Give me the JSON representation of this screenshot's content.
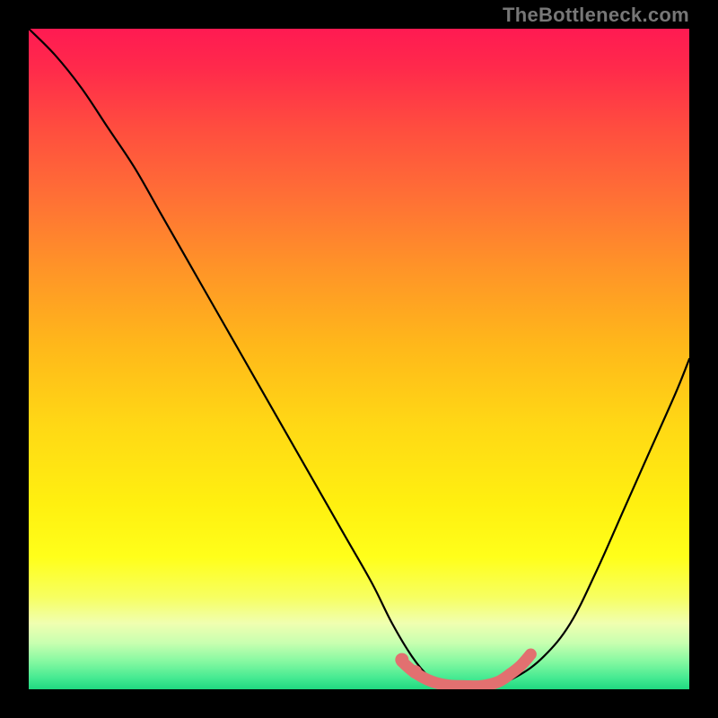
{
  "watermark": "TheBottleneck.com",
  "colors": {
    "frame": "#000000",
    "curve": "#000000",
    "marker": "#e27070",
    "watermark": "#777777"
  },
  "gradient_stops": [
    {
      "offset": 0.0,
      "color": "#ff1a52"
    },
    {
      "offset": 0.06,
      "color": "#ff2a4b"
    },
    {
      "offset": 0.15,
      "color": "#ff4d3f"
    },
    {
      "offset": 0.25,
      "color": "#ff6e36"
    },
    {
      "offset": 0.36,
      "color": "#ff9328"
    },
    {
      "offset": 0.48,
      "color": "#ffb81a"
    },
    {
      "offset": 0.6,
      "color": "#ffd815"
    },
    {
      "offset": 0.72,
      "color": "#fff010"
    },
    {
      "offset": 0.8,
      "color": "#ffff1a"
    },
    {
      "offset": 0.86,
      "color": "#f7ff60"
    },
    {
      "offset": 0.9,
      "color": "#f0ffb0"
    },
    {
      "offset": 0.93,
      "color": "#c8ffb0"
    },
    {
      "offset": 0.96,
      "color": "#80f8a0"
    },
    {
      "offset": 0.985,
      "color": "#40e890"
    },
    {
      "offset": 1.0,
      "color": "#20d880"
    }
  ],
  "chart_data": {
    "type": "line",
    "title": "",
    "xlabel": "",
    "ylabel": "",
    "xlim": [
      0,
      100
    ],
    "ylim": [
      0,
      100
    ],
    "grid": false,
    "series": [
      {
        "name": "bottleneck-curve",
        "x": [
          0,
          4,
          8,
          12,
          16,
          20,
          24,
          28,
          32,
          36,
          40,
          44,
          48,
          52,
          55,
          58,
          60.5,
          63,
          66,
          70,
          74,
          78,
          82,
          86,
          90,
          94,
          98,
          100
        ],
        "y": [
          100,
          96,
          91,
          85,
          79,
          72,
          65,
          58,
          51,
          44,
          37,
          30,
          23,
          16,
          10,
          5,
          2,
          0.5,
          0.5,
          0.5,
          2,
          5,
          10,
          18,
          27,
          36,
          45,
          50
        ]
      }
    ],
    "markers": {
      "name": "highlight-segment",
      "x": [
        56.5,
        58.5,
        61,
        63.5,
        66,
        68.5,
        71,
        73,
        74.5,
        76
      ],
      "y": [
        4.2,
        2.5,
        1.2,
        0.6,
        0.5,
        0.5,
        1.1,
        2.4,
        3.6,
        5.3
      ]
    }
  }
}
